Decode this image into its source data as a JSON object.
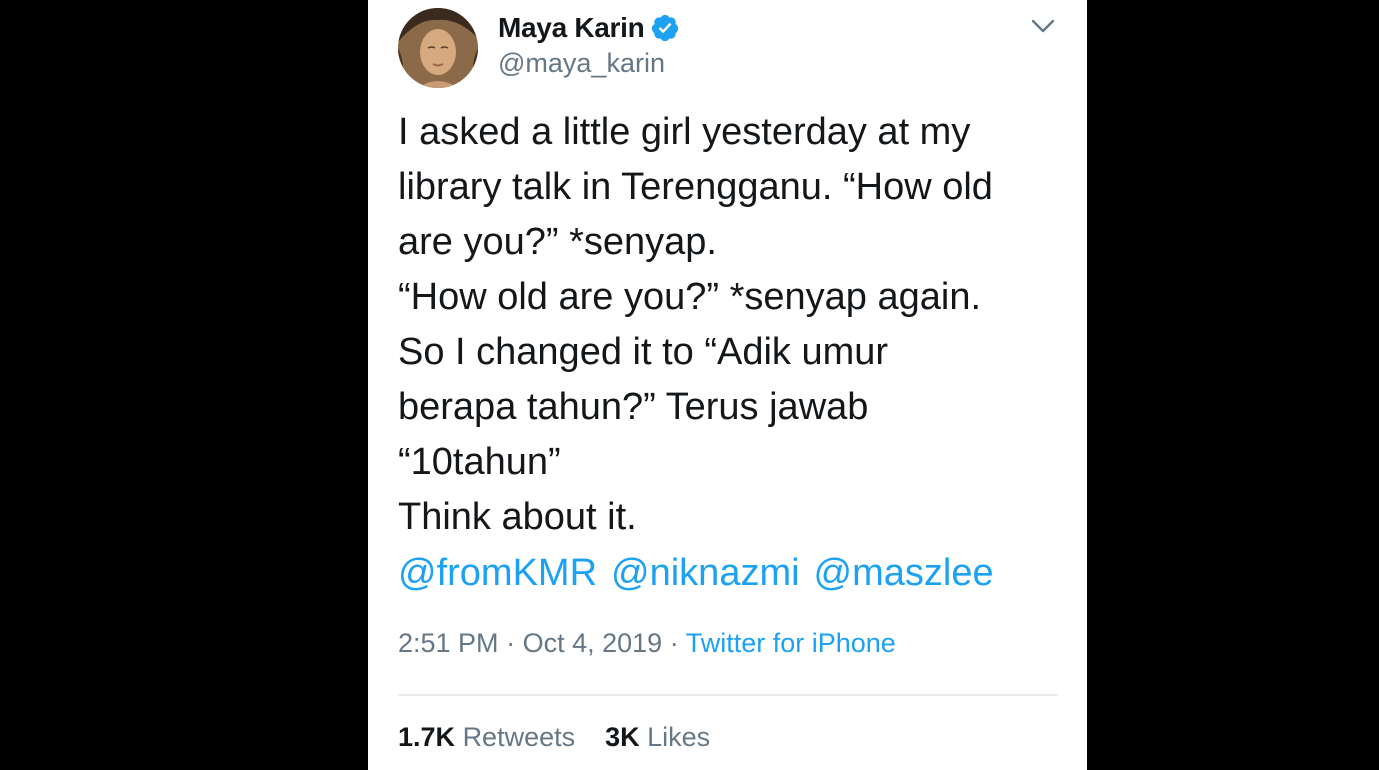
{
  "author": {
    "display_name": "Maya Karin",
    "handle": "@maya_karin",
    "verified_icon": "verified-badge-icon"
  },
  "tweet": {
    "lines": [
      "I asked a little girl yesterday at my",
      "library talk in Terengganu. “How old",
      "are you?” *senyap.",
      "“How old are you?” *senyap again.",
      "So I changed it to “Adik umur",
      "berapa tahun?” Terus jawab",
      "“10tahun”",
      "Think about it."
    ],
    "mentions": [
      "@fromKMR",
      "@niknazmi",
      "@maszlee"
    ]
  },
  "meta": {
    "time": "2:51 PM",
    "separator": "·",
    "date": "Oct 4, 2019",
    "source": "Twitter for iPhone"
  },
  "stats": {
    "retweets_count": "1.7K",
    "retweets_label": "Retweets",
    "likes_count": "3K",
    "likes_label": "Likes"
  },
  "colors": {
    "text": "#14171a",
    "secondary": "#657786",
    "link": "#1da1f2",
    "background": "#000000",
    "card": "#ffffff"
  }
}
